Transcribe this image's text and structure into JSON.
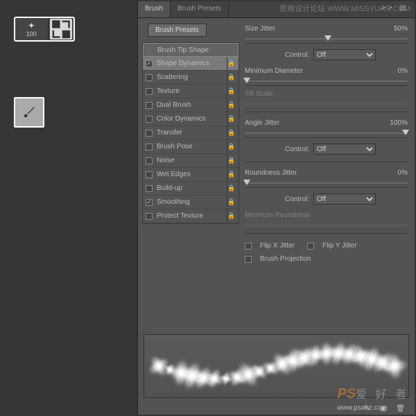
{
  "watermark_top": "思缘设计论坛  WWW.MISSYUAN.COM",
  "watermark_bottom": {
    "logo": "PS",
    "cn": "爱 好 者",
    "url": "www.psahz.com"
  },
  "brush_size": "100",
  "tabs": {
    "brush": "Brush",
    "presets": "Brush Presets",
    "more": ">>"
  },
  "buttons": {
    "brush_presets": "Brush Presets"
  },
  "list": {
    "header": "Brush Tip Shape",
    "items": [
      {
        "label": "Shape Dynamics",
        "checked": true,
        "active": true
      },
      {
        "label": "Scattering",
        "checked": false
      },
      {
        "label": "Texture",
        "checked": false
      },
      {
        "label": "Dual Brush",
        "checked": false
      },
      {
        "label": "Color Dynamics",
        "checked": false
      },
      {
        "label": "Transfer",
        "checked": false
      },
      {
        "label": "Brush Pose",
        "checked": false
      },
      {
        "label": "Noise",
        "checked": false
      },
      {
        "label": "Wet Edges",
        "checked": false
      },
      {
        "label": "Build-up",
        "checked": false
      },
      {
        "label": "Smoothing",
        "checked": true
      },
      {
        "label": "Protect Texture",
        "checked": false
      }
    ]
  },
  "sliders": {
    "size_jitter": {
      "label": "Size Jitter",
      "value": "50%",
      "pos": 50
    },
    "min_diameter": {
      "label": "Minimum Diameter",
      "value": "0%",
      "pos": 0
    },
    "tilt_scale": {
      "label": "Tilt Scale",
      "value": "",
      "pos": 0,
      "disabled": true
    },
    "angle_jitter": {
      "label": "Angle Jitter",
      "value": "100%",
      "pos": 100
    },
    "roundness_jitter": {
      "label": "Roundness Jitter",
      "value": "0%",
      "pos": 0
    },
    "min_roundness": {
      "label": "Minimum Roundness",
      "value": "",
      "pos": 0,
      "disabled": true
    }
  },
  "control": {
    "label": "Control:",
    "value": "Off"
  },
  "checks": {
    "flipx": "Flip X Jitter",
    "flipy": "Flip Y Jitter",
    "projection": "Brush Projection"
  }
}
